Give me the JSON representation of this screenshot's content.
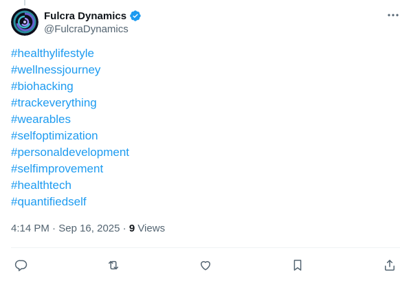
{
  "post": {
    "author": {
      "display_name": "Fulcra Dynamics",
      "handle": "@FulcraDynamics",
      "verified": true
    },
    "hashtags": [
      "#healthylifestyle",
      "#wellnessjourney",
      "#biohacking",
      "#trackeverything",
      "#wearables",
      "#selfoptimization",
      "#personaldevelopment",
      "#selfimprovement",
      "#healthtech",
      "#quantifiedself"
    ],
    "time": "4:14 PM",
    "separator": " · ",
    "date": "Sep 16, 2025",
    "views_count": "9",
    "views_label": "Views"
  },
  "actions": [
    {
      "name": "reply-button",
      "icon": "reply-icon"
    },
    {
      "name": "repost-button",
      "icon": "repost-icon"
    },
    {
      "name": "like-button",
      "icon": "heart-icon"
    },
    {
      "name": "bookmark-button",
      "icon": "bookmark-icon"
    },
    {
      "name": "share-button",
      "icon": "share-icon"
    }
  ],
  "colors": {
    "accent": "#1d9bf0",
    "text": "#0f1419",
    "secondary": "#536471",
    "divider": "#eff3f4"
  }
}
